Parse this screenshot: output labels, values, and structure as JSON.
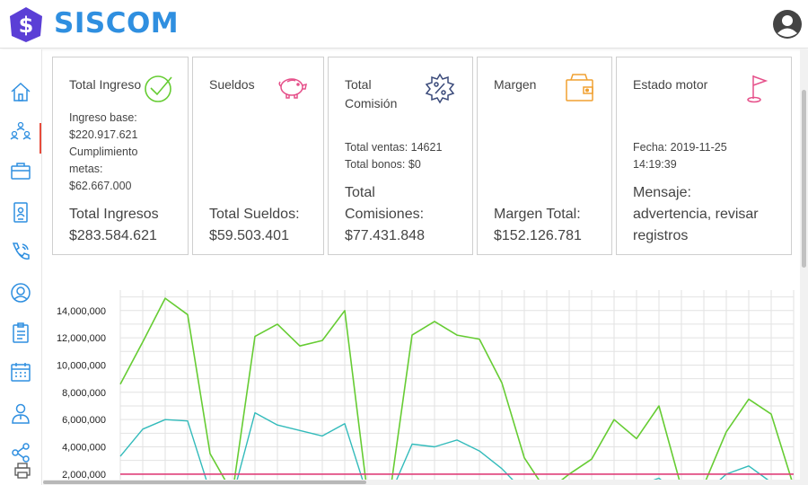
{
  "app": {
    "brand": "SISCOM"
  },
  "icons": {
    "logo": "dollar-hexagon-icon",
    "user": "user-avatar-icon",
    "sidebar": [
      "home-icon",
      "users-group-icon",
      "briefcase-icon",
      "id-badge-icon",
      "phone-icon",
      "support-agent-icon",
      "clipboard-icon",
      "calendar-icon",
      "employee-icon",
      "share-icon",
      "printer-icon"
    ]
  },
  "colors": {
    "brand": "#2f8fe0",
    "logo": "#5b3fd6",
    "series_green": "#66cc33",
    "series_teal": "#33bbbb",
    "threshold": "#e0407a"
  },
  "cards": [
    {
      "title": "Total Ingreso",
      "icon": "check-circle-icon",
      "details": [
        "Ingreso base:",
        "$220.917.621",
        "Cumplimiento",
        "metas:",
        "$62.667.000"
      ],
      "total_label": "Total Ingresos",
      "total_value": "$283.584.621"
    },
    {
      "title": "Sueldos",
      "icon": "piggy-bank-icon",
      "total_label": "Total Sueldos:",
      "total_value": "$59.503.401"
    },
    {
      "title_lines": [
        "Total",
        "Comisión"
      ],
      "icon": "gear-percent-icon",
      "details": [
        "Total ventas: 14621",
        "Total bonos: $0"
      ],
      "total_lines": [
        "Total",
        "Comisiones:",
        "$77.431.848"
      ]
    },
    {
      "title": "Margen",
      "icon": "wallet-icon",
      "total_label": "Margen Total:",
      "total_value": "$152.126.781"
    },
    {
      "title": "Estado motor",
      "icon": "flag-icon",
      "details": [
        "Fecha: 2019-11-25",
        "14:19:39"
      ],
      "total_lines": [
        "Mensaje:",
        "advertencia, revisar",
        "registros"
      ]
    }
  ],
  "chart_data": {
    "type": "line",
    "title": "",
    "xlabel": "",
    "ylabel": "",
    "ylim": [
      1200000,
      15500000
    ],
    "yticks": [
      "14,000,000",
      "12,000,000",
      "10,000,000",
      "8,000,000",
      "6,000,000",
      "4,000,000",
      "2,000,000"
    ],
    "grid": true,
    "x": [
      0,
      1,
      2,
      3,
      4,
      5,
      6,
      7,
      8,
      9,
      10,
      11,
      12,
      13,
      14,
      15,
      16,
      17,
      18,
      19,
      20,
      21,
      22,
      23,
      24,
      25,
      26,
      27,
      28,
      29,
      30
    ],
    "series": [
      {
        "values": [
          8600000,
          11700000,
          14900000,
          13700000,
          3500000,
          600000,
          12100000,
          13000000,
          11400000,
          11800000,
          14000000,
          700000,
          400000,
          12200000,
          13200000,
          12200000,
          11900000,
          8700000,
          3200000,
          700000,
          2000000,
          3100000,
          6000000,
          4600000,
          7000000,
          1000000,
          1200000,
          5100000,
          7500000,
          6400000,
          1100000
        ]
      },
      {
        "values": [
          3300000,
          5300000,
          6000000,
          5900000,
          700000,
          300000,
          6500000,
          5600000,
          5200000,
          4800000,
          5700000,
          500000,
          400000,
          4200000,
          4000000,
          4500000,
          3700000,
          2400000,
          700000,
          300000,
          400000,
          500000,
          700000,
          1100000,
          1700000,
          300000,
          500000,
          2000000,
          2600000,
          1400000,
          500000
        ]
      },
      {
        "values": [
          2000000,
          2000000,
          2000000,
          2000000,
          2000000,
          2000000,
          2000000,
          2000000,
          2000000,
          2000000,
          2000000,
          2000000,
          2000000,
          2000000,
          2000000,
          2000000,
          2000000,
          2000000,
          2000000,
          2000000,
          2000000,
          2000000,
          2000000,
          2000000,
          2000000,
          2000000,
          2000000,
          2000000,
          2000000,
          2000000,
          2000000
        ]
      }
    ]
  }
}
